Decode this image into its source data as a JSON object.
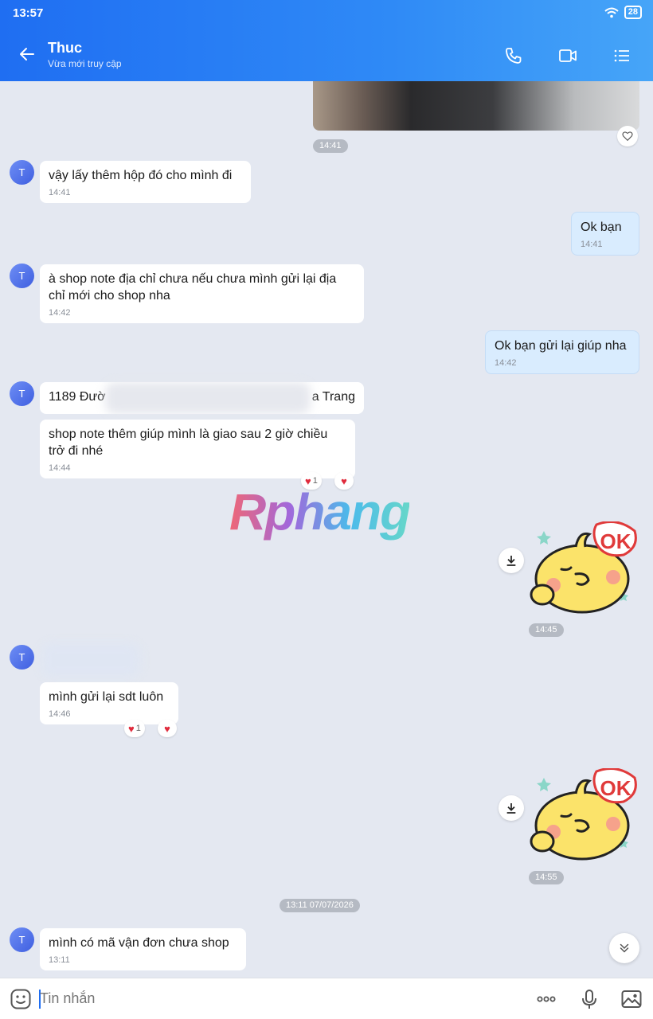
{
  "status": {
    "time": "13:57",
    "battery": "28"
  },
  "header": {
    "title": "Thuc",
    "subtitle": "Vừa mới truy cập"
  },
  "avatar_letter": "T",
  "messages": {
    "m1": {
      "text": "vậy lấy thêm hộp đó cho mình đi",
      "time": "14:41"
    },
    "m2": {
      "text": "Ok bạn",
      "time": "14:41"
    },
    "m3": {
      "text": "à shop note địa chỉ chưa nếu chưa mình gửi lại địa chỉ mới cho shop nha",
      "time": "14:42"
    },
    "m4": {
      "text": "Ok bạn gửi lại giúp nha",
      "time": "14:42"
    },
    "m5a": {
      "text": "1189 Đườ",
      "text_end": "a Trang"
    },
    "m5b": {
      "text": "shop note thêm giúp mình là giao sau 2 giờ chiều trở đi nhé",
      "time": "14:44"
    },
    "m6": {
      "text": "mình gửi lại sdt luôn",
      "time": "14:46"
    },
    "m7": {
      "text": "mình có mã vận đơn chưa shop",
      "time": "13:11"
    }
  },
  "photo_time": "14:41",
  "sticker1_time": "14:45",
  "sticker2_time": "14:55",
  "sticker_text": "OK",
  "date_divider": "13:11 07/07/2026",
  "reaction_count": "1",
  "watermark": "Rphang",
  "input": {
    "placeholder": "Tin nhắn"
  },
  "icons": [
    "back-arrow-icon",
    "phone-icon",
    "video-call-icon",
    "list-menu-icon",
    "heart-icon",
    "download-icon",
    "chevron-down-icon",
    "emoji-icon",
    "more-icon",
    "microphone-icon",
    "image-icon"
  ]
}
